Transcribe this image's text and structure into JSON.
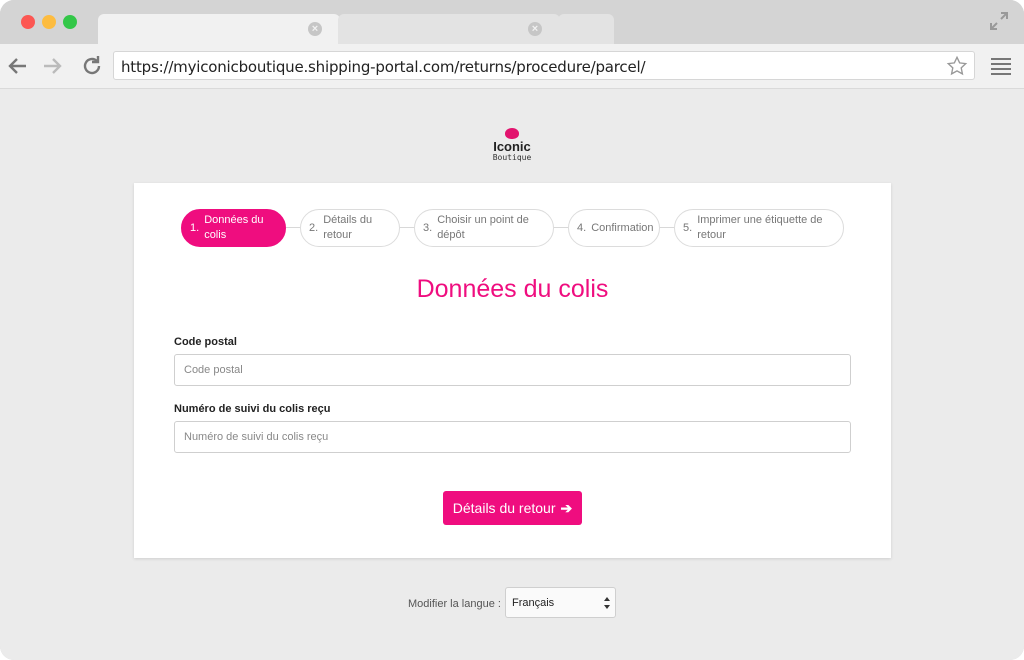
{
  "browser": {
    "url": "https://myiconicboutique.shipping-portal.com/returns/procedure/parcel/"
  },
  "logo": {
    "main": "Iconic",
    "sub": "Boutique",
    "brand_color": "#e2136e"
  },
  "steps": [
    {
      "num": "1.",
      "label": "Données du colis",
      "active": true
    },
    {
      "num": "2.",
      "label": "Détails du retour",
      "active": false
    },
    {
      "num": "3.",
      "label": "Choisir un point de dépôt",
      "active": false
    },
    {
      "num": "4.",
      "label": "Confirmation",
      "active": false
    },
    {
      "num": "5.",
      "label": "Imprimer une étiquette de retour",
      "active": false
    }
  ],
  "form": {
    "title": "Données du colis",
    "postal_code": {
      "label": "Code postal",
      "placeholder": "Code postal",
      "value": ""
    },
    "tracking": {
      "label": "Numéro de suivi du colis reçu",
      "placeholder": "Numéro de suivi du colis reçu",
      "value": ""
    },
    "submit_label": "Détails du retour"
  },
  "language": {
    "label": "Modifier la langue :",
    "selected": "Français"
  },
  "colors": {
    "accent": "#ef0d7f",
    "background": "#ebebeb"
  }
}
